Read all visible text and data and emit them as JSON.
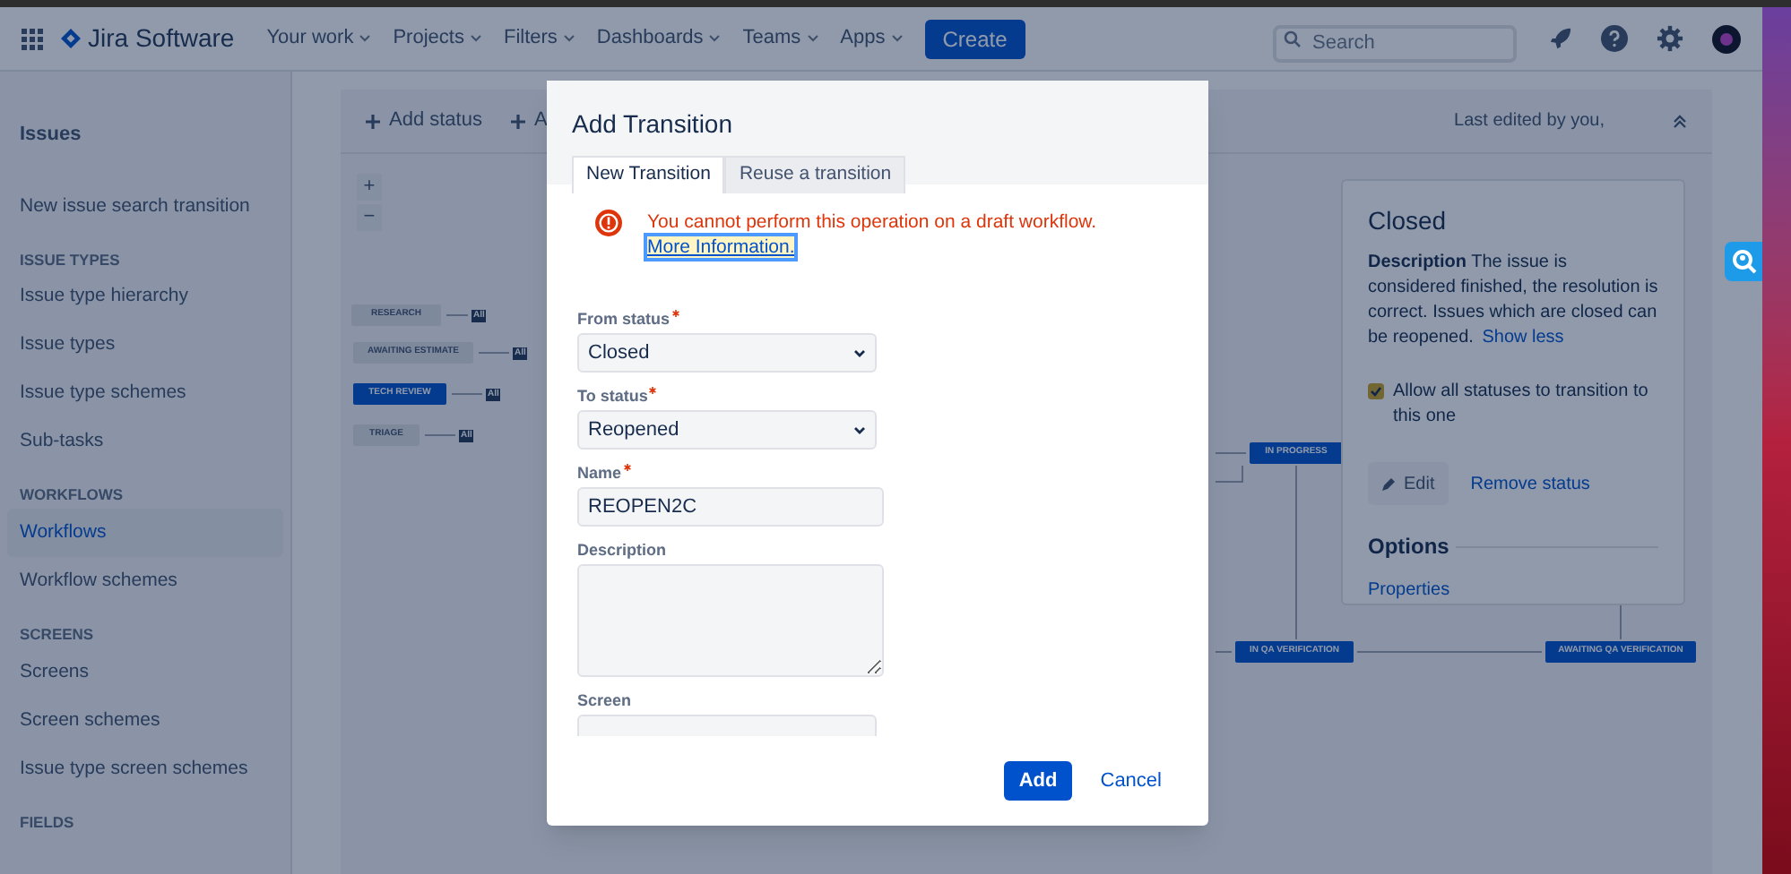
{
  "header": {
    "app_name": "Jira Software",
    "nav": [
      {
        "label": "Your work"
      },
      {
        "label": "Projects"
      },
      {
        "label": "Filters"
      },
      {
        "label": "Dashboards"
      },
      {
        "label": "Teams"
      },
      {
        "label": "Apps"
      }
    ],
    "create_button": "Create",
    "search": {
      "placeholder": "Search"
    }
  },
  "sidebar": {
    "title": "Issues",
    "items": [
      {
        "label": "New issue search transition",
        "selected": false
      }
    ],
    "groups": [
      {
        "heading": "ISSUE TYPES",
        "items": [
          {
            "label": "Issue type hierarchy",
            "selected": false
          },
          {
            "label": "Issue types",
            "selected": false
          },
          {
            "label": "Issue type schemes",
            "selected": false
          },
          {
            "label": "Sub-tasks",
            "selected": false
          }
        ]
      },
      {
        "heading": "WORKFLOWS",
        "items": [
          {
            "label": "Workflows",
            "selected": true
          },
          {
            "label": "Workflow schemes",
            "selected": false
          }
        ]
      },
      {
        "heading": "SCREENS",
        "items": [
          {
            "label": "Screens",
            "selected": false
          },
          {
            "label": "Screen schemes",
            "selected": false
          },
          {
            "label": "Issue type screen schemes",
            "selected": false
          }
        ]
      },
      {
        "heading": "FIELDS"
      }
    ]
  },
  "toolbar": {
    "actions": [
      "Add status",
      "A"
    ],
    "last_edited": "Last edited by you,"
  },
  "zoom_controls": [
    "+",
    "−"
  ],
  "diagram": {
    "nodes": [
      {
        "label": "RESEARCH",
        "highlighted": false,
        "badge": "All"
      },
      {
        "label": "AWAITING ESTIMATE",
        "highlighted": false,
        "badge": "All"
      },
      {
        "label": "TECH REVIEW",
        "highlighted": true,
        "badge": "All"
      },
      {
        "label": "TRIAGE",
        "highlighted": false,
        "badge": "All"
      },
      {
        "label": "IN PROGRESS",
        "highlighted": true
      },
      {
        "label": "IN QA VERIFICATION",
        "highlighted": true
      },
      {
        "label": "AWAITING QA VERIFICATION",
        "highlighted": true
      }
    ]
  },
  "status_panel": {
    "title": "Closed",
    "description_label": "Description",
    "description": "The issue is considered finished, the resolution is correct. Issues which are closed can be reopened.",
    "show_less": "Show less",
    "allow_all": {
      "label": "Allow all statuses to transition to this one",
      "checked": true
    },
    "edit_button": "Edit",
    "remove_link": "Remove status",
    "options_heading": "Options",
    "properties_link": "Properties"
  },
  "dialog": {
    "title": "Add Transition",
    "tabs": [
      {
        "label": "New Transition",
        "selected": true
      },
      {
        "label": "Reuse a transition",
        "selected": false
      }
    ],
    "error": {
      "message": "You cannot perform this operation on a draft workflow.",
      "link": "More Information."
    },
    "fields": [
      {
        "kind": "select",
        "label": "From status",
        "required": true,
        "value": "Closed"
      },
      {
        "kind": "select",
        "label": "To status",
        "required": true,
        "value": "Reopened"
      },
      {
        "kind": "text",
        "label": "Name",
        "required": true,
        "value": "REOPEN2C"
      },
      {
        "kind": "textarea",
        "label": "Description",
        "required": false
      },
      {
        "kind": "cutoff",
        "label": "Screen",
        "required": false
      }
    ],
    "add_button": "Add",
    "cancel_button": "Cancel"
  }
}
